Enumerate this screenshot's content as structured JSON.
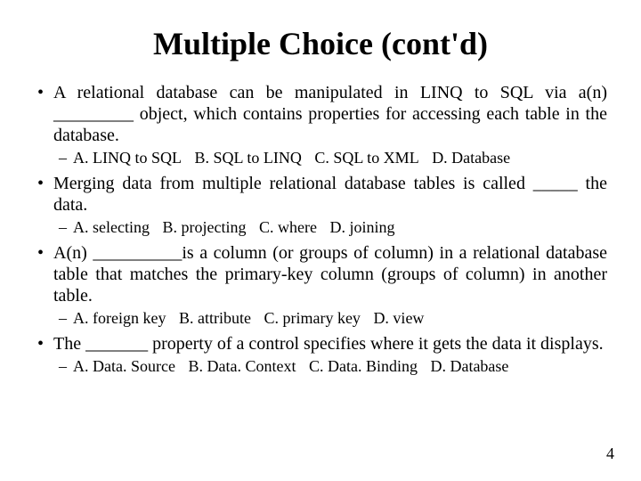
{
  "title": "Multiple Choice (cont'd)",
  "page_number": "4",
  "questions": [
    {
      "text": "A relational database can be manipulated in LINQ to SQL via a(n) _________ object, which contains properties for accessing each table in the database.",
      "options": {
        "a": "A. LINQ to SQL",
        "b": "B. SQL to LINQ",
        "c": "C. SQL to XML",
        "d": "D. Database"
      }
    },
    {
      "text": "Merging data from multiple relational database tables is called _____ the data.",
      "options": {
        "a": "A. selecting",
        "b": "B. projecting",
        "c": "C. where",
        "d": "D. joining"
      }
    },
    {
      "text": "A(n) __________is a column (or groups of column) in a relational database table that matches the primary-key column (groups of column) in another table.",
      "options": {
        "a": "A. foreign key",
        "b": "B. attribute",
        "c": "C. primary key",
        "d": "D. view"
      }
    },
    {
      "text": "The _______ property of a control specifies where it gets the data it displays.",
      "options": {
        "a": "A. Data. Source",
        "b": "B. Data. Context",
        "c": "C. Data. Binding",
        "d": "D. Database"
      }
    }
  ]
}
